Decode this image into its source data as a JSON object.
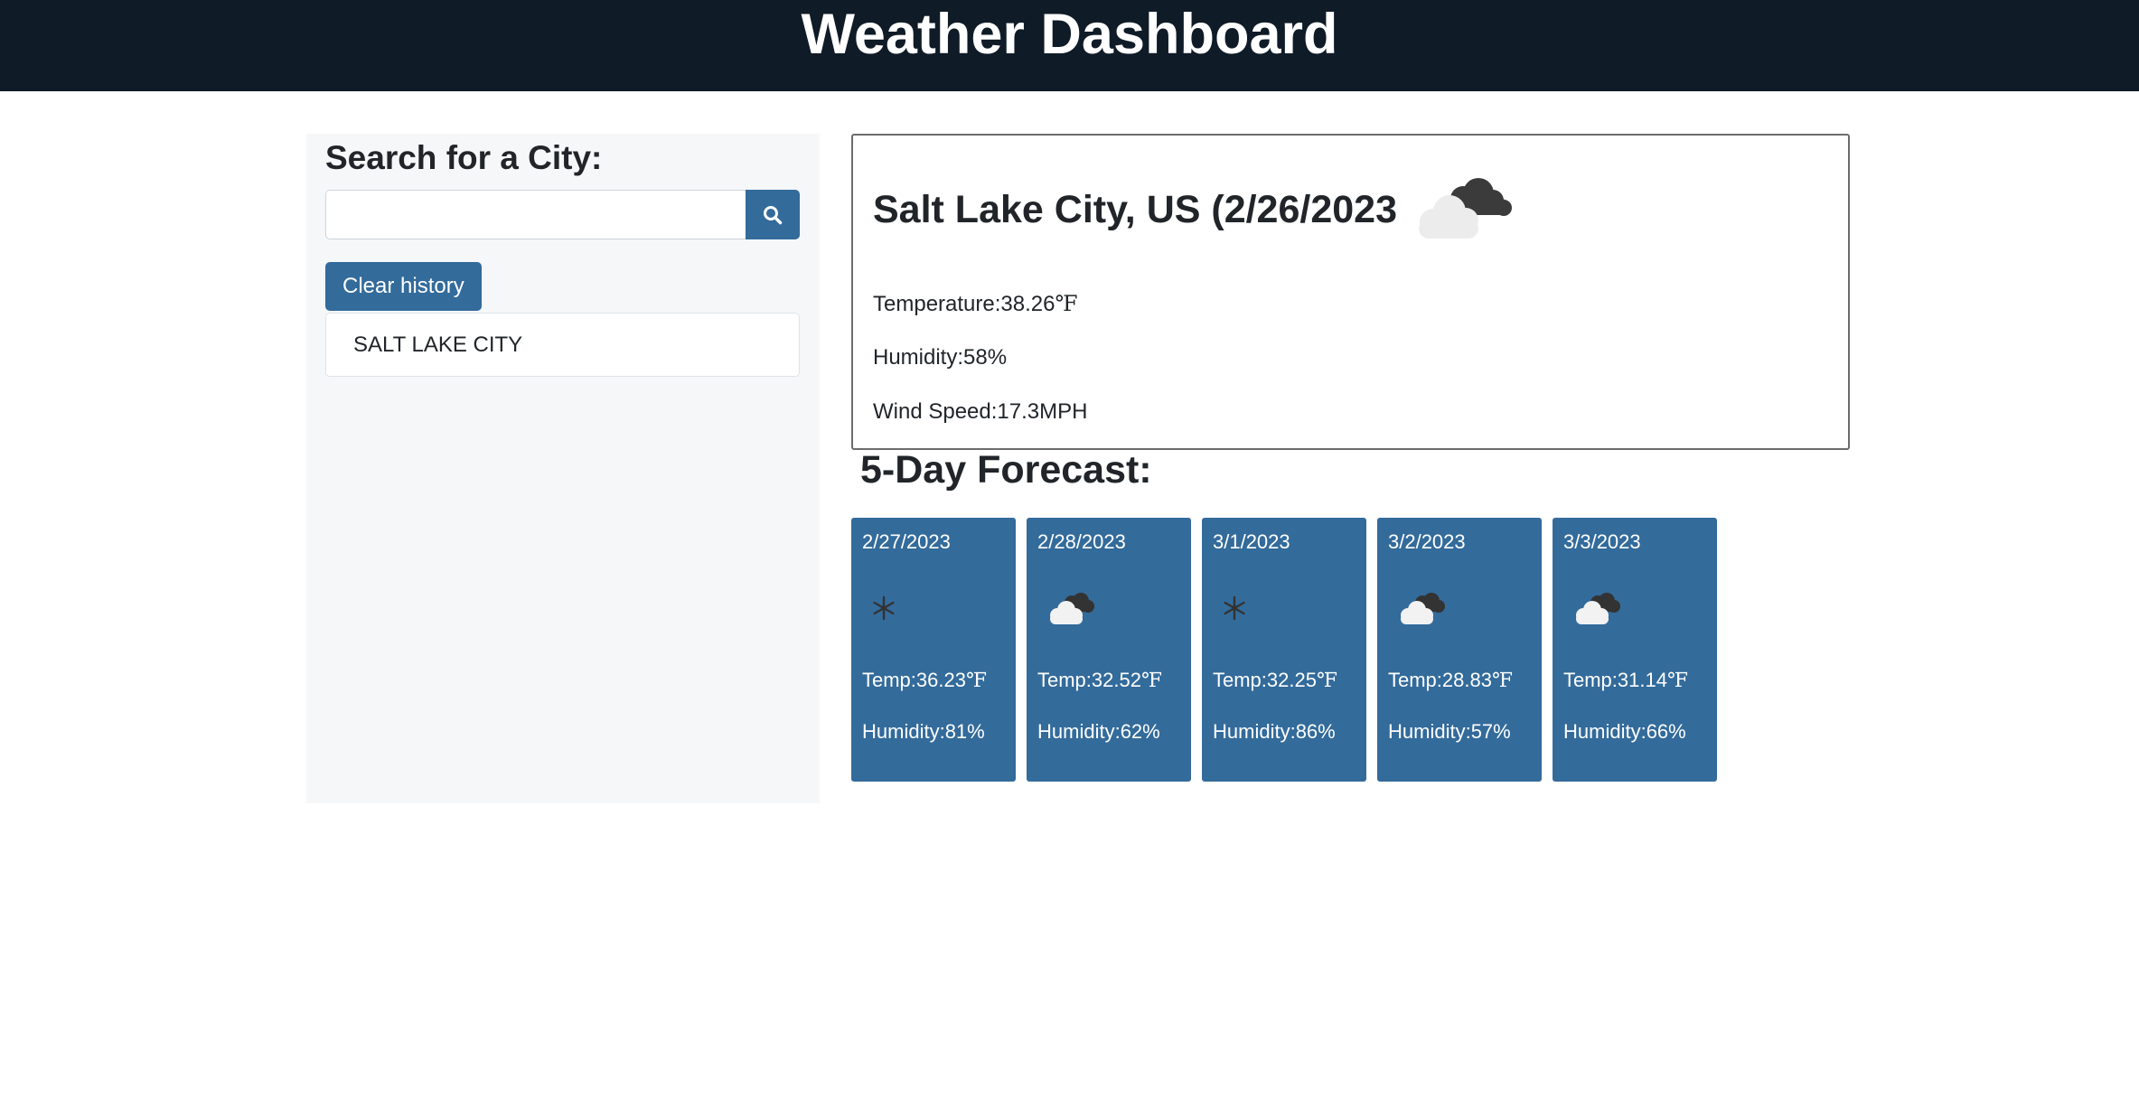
{
  "header": {
    "title": "Weather Dashboard"
  },
  "sidebar": {
    "search_title": "Search for a City:",
    "search_value": "",
    "search_placeholder": "",
    "search_button_icon": "search-icon",
    "clear_label": "Clear history",
    "history": [
      "SALT LAKE CITY"
    ]
  },
  "current": {
    "title": "Salt Lake City, US (2/26/2023",
    "icon": "broken-clouds-icon",
    "temperature_label": "Temperature:",
    "temperature_value": "38.26",
    "temperature_unit": "℉",
    "humidity_label": "Humidity:",
    "humidity_value": "58%",
    "wind_label": "Wind Speed:",
    "wind_value": "17.3MPH"
  },
  "forecast": {
    "title": "5-Day Forecast:",
    "temp_label": "Temp:",
    "temp_unit": "℉",
    "humidity_label": "Humidity:",
    "days": [
      {
        "date": "2/27/2023",
        "icon": "snow-icon",
        "temp": "36.23",
        "humidity": "81%"
      },
      {
        "date": "2/28/2023",
        "icon": "broken-clouds-icon",
        "temp": "32.52",
        "humidity": "62%"
      },
      {
        "date": "3/1/2023",
        "icon": "snow-icon",
        "temp": "32.25",
        "humidity": "86%"
      },
      {
        "date": "3/2/2023",
        "icon": "broken-clouds-icon",
        "temp": "28.83",
        "humidity": "57%"
      },
      {
        "date": "3/3/2023",
        "icon": "broken-clouds-icon",
        "temp": "31.14",
        "humidity": "66%"
      }
    ]
  },
  "colors": {
    "header_bg": "#0f1b27",
    "accent": "#336b9b",
    "sidebar_bg": "#f6f7f9"
  }
}
